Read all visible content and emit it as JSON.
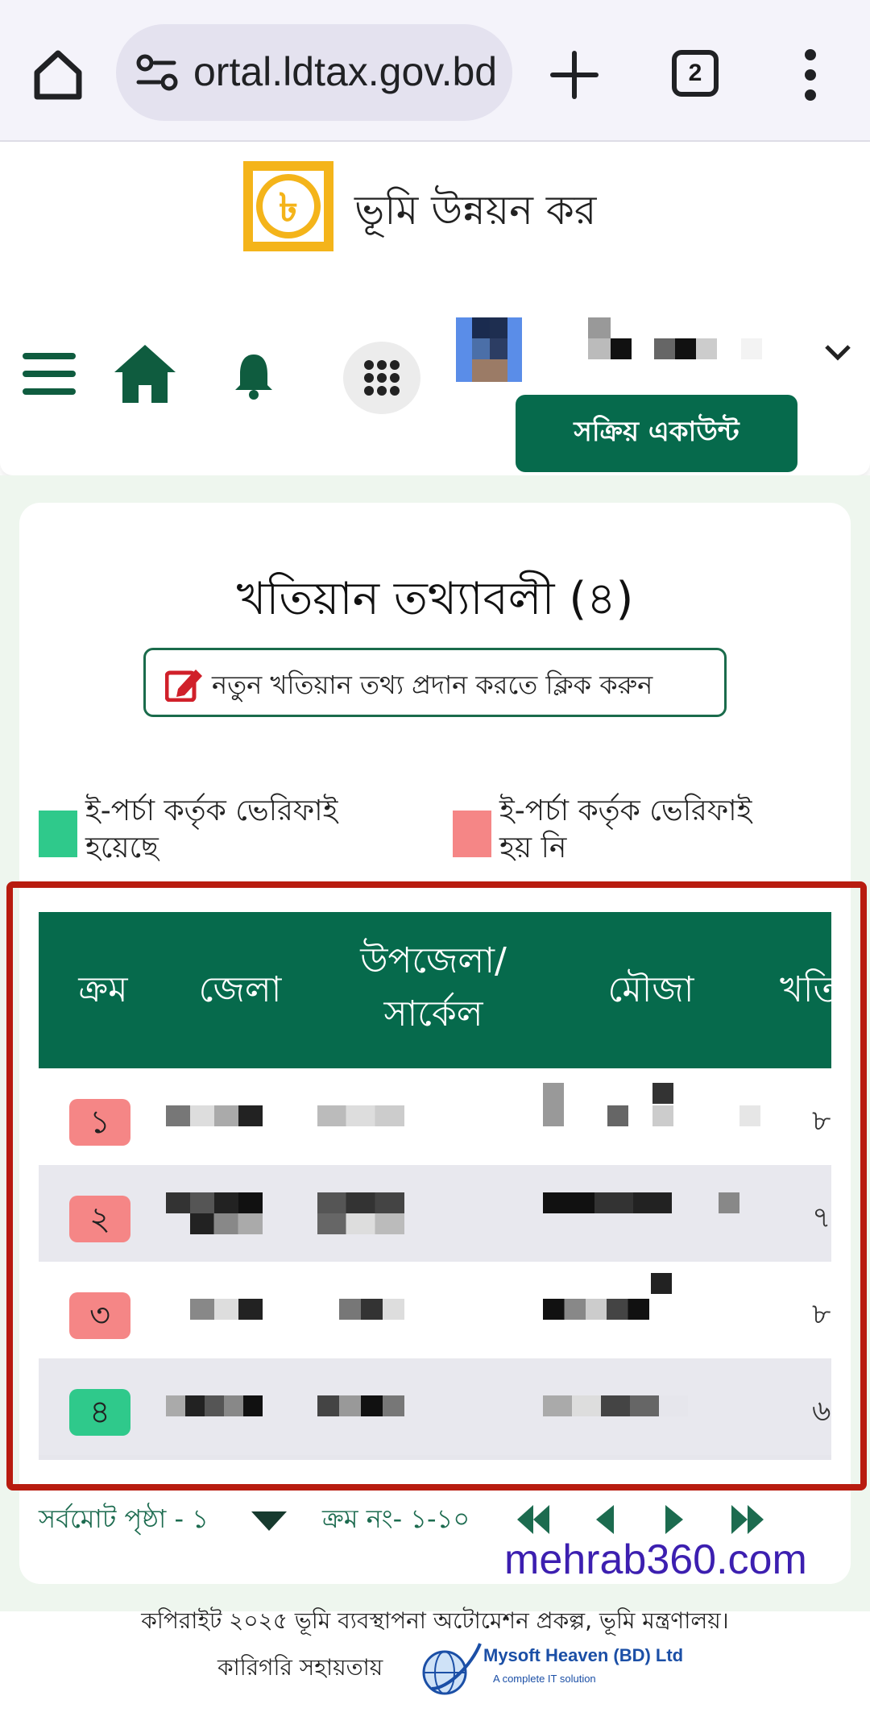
{
  "browser": {
    "url": "ortal.ldtax.gov.bd",
    "tab_count": "2",
    "colors": {
      "bar_bg": "#f4f3fa",
      "pill_bg": "#e4e2ef"
    }
  },
  "header": {
    "site_title": "ভূমি উন্নয়ন কর",
    "logo_symbol": "৳",
    "active_account_label": "সক্রিয় একাউন্ট",
    "icons": [
      "hamburger-icon",
      "home-icon",
      "bell-icon",
      "apps-grid-icon",
      "chevron-down-icon"
    ]
  },
  "main": {
    "title": "খতিয়ান তথ্যাবলী (৪)",
    "new_khatian_label": "নতুন খতিয়ান তথ্য প্রদান করতে ক্লিক করুন",
    "legend": [
      {
        "label_line1": "ই-পর্চা কর্তৃক ভেরিফাই",
        "label_line2": "হয়েছে",
        "color": "#2fc98b"
      },
      {
        "label_line1": "ই-পর্চা কর্তৃক ভেরিফাই",
        "label_line2": "হয় নি",
        "color": "#f58686"
      }
    ]
  },
  "table": {
    "headers": [
      "ক্রম",
      "জেলা",
      "উপজেলা/",
      "সার্কেল",
      "মৌজা",
      "খতি"
    ],
    "rows": [
      {
        "serial": "১",
        "tail": "৮",
        "status_color": "#f58686"
      },
      {
        "serial": "২",
        "tail": "৭",
        "status_color": "#f58686"
      },
      {
        "serial": "৩",
        "tail": "৮",
        "status_color": "#f58686"
      },
      {
        "serial": "৪",
        "tail": "৬",
        "status_color": "#2fc98b"
      }
    ],
    "colors": {
      "header_bg": "#066a4c",
      "highlight_border": "#b81c0f"
    }
  },
  "pagination": {
    "total_pages": "সর্বমোট পৃষ্ঠা - ১",
    "range": "ক্রম নং- ১-১০",
    "icons": [
      "caret-down-icon",
      "first-page-icon",
      "prev-page-icon",
      "next-page-icon",
      "last-page-icon"
    ]
  },
  "watermark": "mehrab360.com",
  "footer": {
    "copyright": "কপিরাইট ২০২৫ ভূমি ব্যবস্থাপনা অটোমেশন প্রকল্প, ভূমি মন্ত্রণালয়।",
    "tech_support": "কারিগরি সহায়তায়",
    "vendor_name": "Mysoft Heaven (BD) Ltd",
    "vendor_tagline": "A complete IT solution"
  }
}
